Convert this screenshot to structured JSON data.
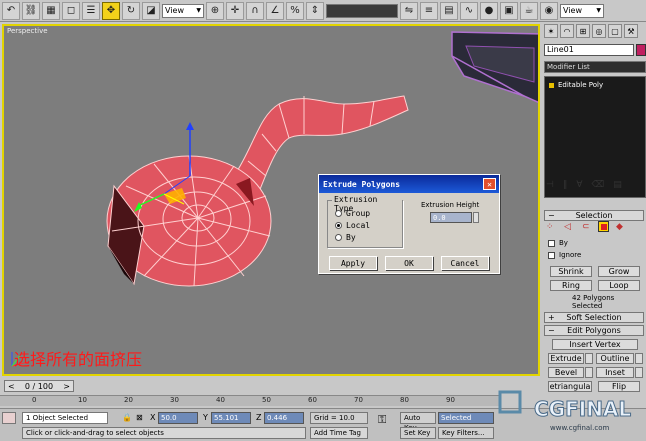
{
  "toolbar": {
    "view_dropdown_1": "View",
    "view_dropdown_2": "View"
  },
  "viewport": {
    "label": "Perspective"
  },
  "dialog": {
    "title": "Extrude Polygons",
    "group_title": "Extrusion Type",
    "options": [
      "Group",
      "Local",
      "By"
    ],
    "selected_option": "Local",
    "height_label": "Extrusion Height",
    "height_value": "0.0",
    "apply_label": "Apply",
    "ok_label": "OK",
    "cancel_label": "Cancel"
  },
  "caption": "选择所有的面挤压",
  "panel": {
    "object_name": "Line01",
    "modifier_list": "Modifier List",
    "stack_item": "Editable Poly",
    "selection_title": "Selection",
    "by_label": "By",
    "ignore_label": "Ignore",
    "shrink": "Shrink",
    "grow": "Grow",
    "ring": "Ring",
    "loop": "Loop",
    "selected_count": "42 Polygons Selected",
    "soft_selection_title": "Soft Selection",
    "edit_polygons_title": "Edit Polygons",
    "insert_vertex": "Insert Vertex",
    "extrude": "Extrude",
    "outline": "Outline",
    "bevel": "Bevel",
    "inset": "Inset",
    "retriangulate": "etriangula",
    "flip": "Flip"
  },
  "timeline": {
    "frame_display": "0 / 100",
    "ticks": [
      "0",
      "10",
      "20",
      "30",
      "40",
      "50",
      "60",
      "70",
      "80",
      "90"
    ]
  },
  "status": {
    "selection": "1 Object Selected",
    "x_label": "X",
    "x_value": "50.0",
    "y_label": "Y",
    "y_value": "55.101",
    "z_label": "Z",
    "z_value": "0.446",
    "grid": "Grid = 10.0",
    "prompt": "Click or click-and-drag to select objects",
    "add_time_tag": "Add Time Tag",
    "auto_key": "Auto Key",
    "set_key": "Set Key",
    "selected_dropdown": "Selected",
    "key_filters": "Key Filters..."
  },
  "watermark": {
    "brand": "CGFINAL",
    "url": "www.cgfinal.com"
  },
  "colors": {
    "mesh": "#e05560",
    "viewport_border": "#e2d400",
    "viewport_bg": "#7d7d7d",
    "caption": "#ff1a1a",
    "object_color": "#c02060"
  }
}
